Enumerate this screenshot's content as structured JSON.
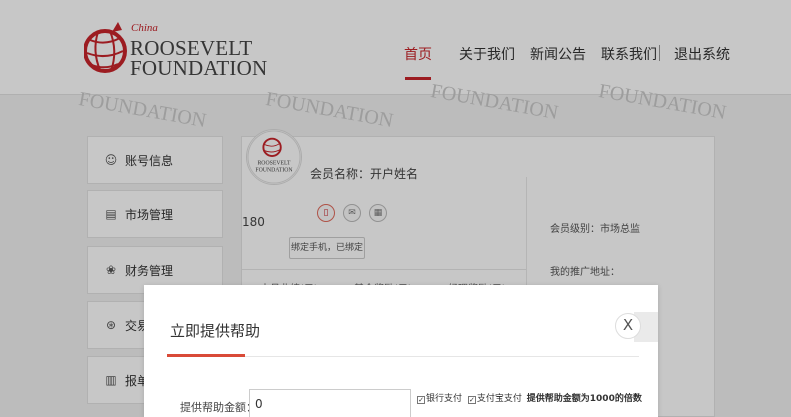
{
  "header": {
    "logo": {
      "china": "China",
      "line1": "ROOSEVELT",
      "line2": "FOUNDATION"
    },
    "nav": [
      {
        "label": "首页",
        "active": true
      },
      {
        "label": "关于我们",
        "active": false
      },
      {
        "label": "新闻公告",
        "active": false
      },
      {
        "label": "联系我们",
        "active": false
      },
      {
        "label": "退出系统",
        "active": false
      }
    ]
  },
  "watermark": {
    "text": "FOUNDATION"
  },
  "sidebar": {
    "items": [
      {
        "label": "账号信息",
        "icon": "user-icon"
      },
      {
        "label": "市场管理",
        "icon": "document-icon"
      },
      {
        "label": "财务管理",
        "icon": "wallet-icon"
      },
      {
        "label": "交易",
        "icon": "exchange-icon"
      },
      {
        "label": "报单",
        "icon": "list-icon"
      }
    ]
  },
  "profile": {
    "member_name": "会员名称：开户姓名",
    "id_number": "180",
    "bind_button": "绑定手机，已绑定",
    "level": "会员级别：市场总监",
    "promo": "我的推广地址：",
    "stats": [
      "本月业绩(元)",
      "基金奖励(元)",
      "经理奖励(元)"
    ]
  },
  "modal": {
    "title": "立即提供帮助",
    "close": "X",
    "amount_label": "提供帮助金额：",
    "amount_value": "0",
    "bank_pay": "银行支付",
    "alipay": "支付宝支付",
    "note": "提供帮助金额为1000的倍数"
  },
  "colors": {
    "accent": "#c8242b",
    "modal_underline": "#d94a38"
  }
}
